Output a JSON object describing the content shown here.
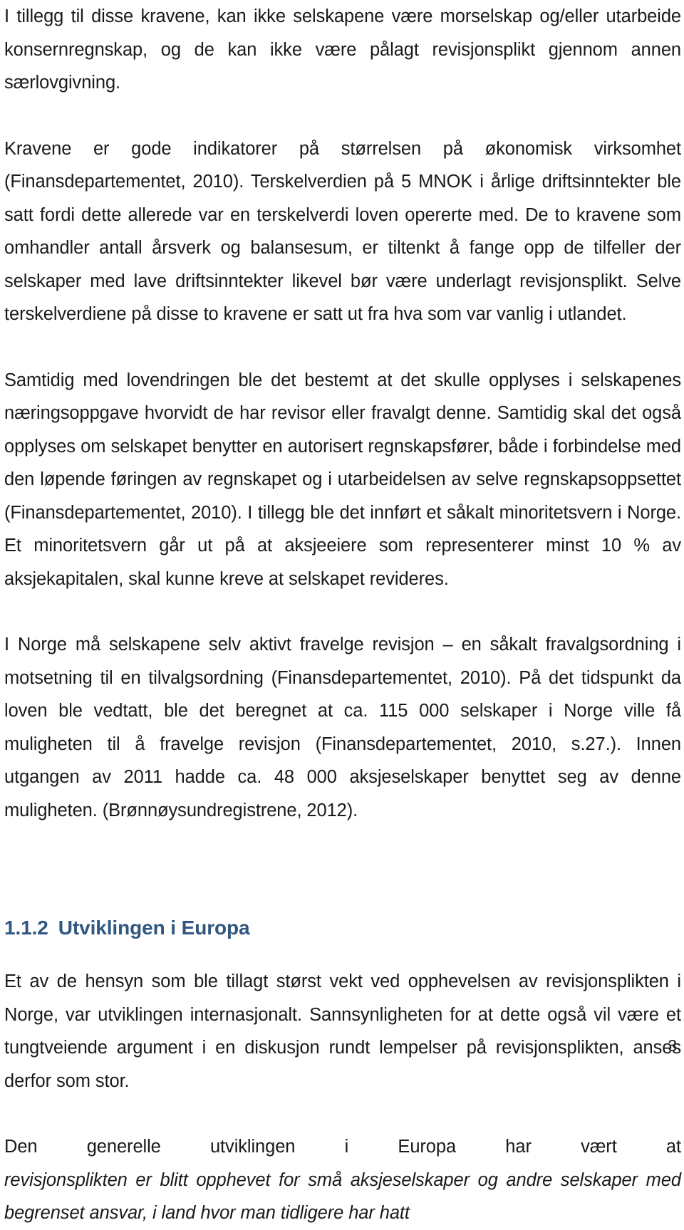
{
  "document": {
    "page_number": "3",
    "heading_color": "#31567f",
    "body_color": "#1a1a1a",
    "background_color": "#ffffff"
  },
  "paragraphs": {
    "p1": "I tillegg til disse kravene, kan ikke selskapene være morselskap og/eller utarbeide konsernregnskap, og de kan ikke være pålagt revisjonsplikt gjennom annen særlovgivning.",
    "p2": "Kravene er gode indikatorer på størrelsen på økonomisk virksomhet (Finansdepartementet, 2010). Terskelverdien på 5 MNOK i årlige driftsinntekter ble satt fordi dette allerede var en terskelverdi loven opererte med. De to kravene som omhandler antall årsverk og balansesum, er tiltenkt å fange opp de tilfeller der selskaper med lave driftsinntekter likevel bør være underlagt revisjonsplikt. Selve terskelverdiene på disse to kravene er satt ut fra hva som var vanlig i utlandet.",
    "p3": "Samtidig med lovendringen ble det bestemt at det skulle opplyses i selskapenes næringsoppgave hvorvidt de har revisor eller fravalgt denne. Samtidig skal det også opplyses om selskapet benytter en autorisert regnskapsfører, både i forbindelse med den løpende føringen av regnskapet og i utarbeidelsen av selve regnskapsoppsettet (Finansdepartementet, 2010). I tillegg ble det innført et såkalt minoritetsvern i Norge. Et minoritetsvern går ut på at aksjeeiere som representerer minst 10 % av aksjekapitalen, skal kunne kreve at selskapet revideres.",
    "p4": "I Norge må selskapene selv aktivt fravelge revisjon – en såkalt fravalgsordning i motsetning til en tilvalgsordning (Finansdepartementet, 2010). På det tidspunkt da loven ble vedtatt, ble det beregnet at ca. 115 000 selskaper i Norge ville få muligheten til å fravelge revisjon (Finansdepartementet, 2010, s.27.). Innen utgangen av 2011 hadde ca. 48 000 aksjeselskaper benyttet seg av denne muligheten. (Brønnøysundregistrene, 2012).",
    "p5": "Et av de hensyn som ble tillagt størst vekt ved opphevelsen av revisjonsplikten i Norge, var utviklingen internasjonalt. Sannsynligheten for at dette også vil være et tungtveiende argument i en diskusjon rundt lempelser på revisjonsplikten, anses derfor som stor.",
    "p6_lead": "Den generelle utviklingen i Europa har vært at ",
    "p6_italic": "revisjonsplikten er blitt opphevet for små aksjeselskaper og andre selskaper med begrenset ansvar, i land hvor man tidligere har hatt"
  },
  "heading": {
    "number": "1.1.2",
    "title": "Utviklingen i Europa"
  }
}
